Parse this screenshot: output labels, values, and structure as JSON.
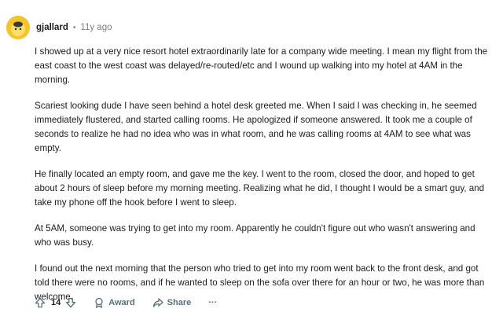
{
  "comment": {
    "username": "gjallard",
    "separator": "•",
    "age": "11y ago",
    "avatar_color": "#f4c430",
    "paragraphs": [
      "I showed up at a very nice resort hotel extraordinarily late for a company wide meeting. I mean my flight from the east coast to the west coast was delayed/re-routed/etc and I wound up walking into my hotel at 4AM in the morning.",
      "Scariest looking dude I have seen behind a hotel desk greeted me. When I said I was checking in, he seemed immediately flustered, and started calling rooms. He apologized if someone answered. It took me a couple of seconds to realize he had no idea who was in what room, and he was calling rooms at 4AM to see what was empty.",
      "He finally located an empty room, and gave me the key. I went to the room, closed the door, and hoped to get about 2 hours of sleep before my morning meeting. Realizing what he did, I thought I would be a smart guy, and take my phone off the hook before I went to sleep.",
      "At 5AM, someone was trying to get into my room. Apparently he couldn't figure out who wasn't answering and who was busy.",
      "I found out the next morning that the person who tried to get into my room went back to the front desk, and got told there were no rooms, and if he wanted to sleep on the sofa over there for an hour or two, he was more than welcome."
    ],
    "actions": {
      "vote_count": "14",
      "award_label": "Award",
      "share_label": "Share",
      "more_label": "···"
    },
    "icons": {
      "upvote": "arrow-up-icon",
      "downvote": "arrow-down-icon",
      "award": "award-icon",
      "share": "share-icon",
      "more": "more-icon"
    }
  }
}
